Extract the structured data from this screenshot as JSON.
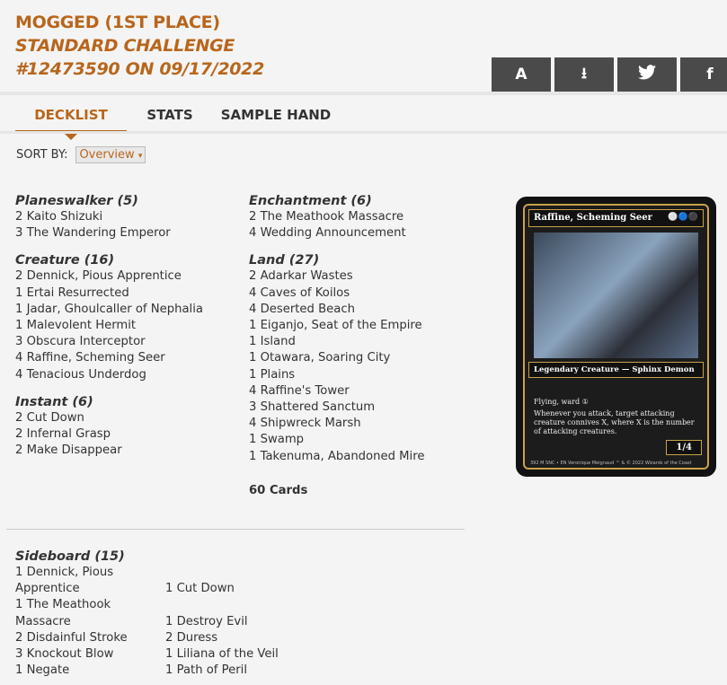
{
  "header": {
    "title": "MOGGED (1ST PLACE)",
    "subtitle1": "STANDARD CHALLENGE",
    "subtitle2": "#12473590 ON 09/17/2022"
  },
  "share": [
    {
      "icon": "arena-icon",
      "label": "A"
    },
    {
      "icon": "download-icon",
      "label": "⭳"
    },
    {
      "icon": "twitter-icon",
      "label": "🐦"
    },
    {
      "icon": "facebook-icon",
      "label": "f"
    }
  ],
  "tabs": [
    "DECKLIST",
    "STATS",
    "SAMPLE HAND"
  ],
  "sort": {
    "label": "SORT BY:",
    "value": "Overview"
  },
  "accent": "#b8661c",
  "left_groups": [
    {
      "title": "Planeswalker (5)",
      "cards": [
        "2 Kaito Shizuki",
        "3 The Wandering Emperor"
      ]
    },
    {
      "title": "Creature (16)",
      "cards": [
        "2 Dennick, Pious Apprentice",
        "1 Ertai Resurrected",
        "1 Jadar, Ghoulcaller of Nephalia",
        "1 Malevolent Hermit",
        "3 Obscura Interceptor",
        "4 Raffine, Scheming Seer",
        "4 Tenacious Underdog"
      ]
    },
    {
      "title": "Instant (6)",
      "cards": [
        "2 Cut Down",
        "2 Infernal Grasp",
        "2 Make Disappear"
      ]
    }
  ],
  "right_groups": [
    {
      "title": "Enchantment (6)",
      "cards": [
        "2 The Meathook Massacre",
        "4 Wedding Announcement"
      ]
    },
    {
      "title": "Land (27)",
      "cards": [
        "2 Adarkar Wastes",
        "4 Caves of Koilos",
        "4 Deserted Beach",
        "1 Eiganjo, Seat of the Empire",
        "1 Island",
        "1 Otawara, Soaring City",
        "1 Plains",
        "4 Raffine's Tower",
        "3 Shattered Sanctum",
        "4 Shipwreck Marsh",
        "1 Swamp",
        "1 Takenuma, Abandoned Mire"
      ]
    }
  ],
  "total": "60 Cards",
  "card": {
    "name": "Raffine, Scheming Seer",
    "mana": "⚪🔵⚫",
    "type": "Legendary Creature — Sphinx Demon",
    "text1": "Flying, ward ①",
    "text2": "Whenever you attack, target attacking creature connives X, where X is the number of attacking creatures.",
    "pt": "1/4",
    "footer": "392 M SNC • EN  Veronique Meignaud   ™ & © 2022 Wizards of the Coast"
  },
  "sideboard": {
    "title": "Sideboard (15)",
    "cards": [
      "1 Dennick, Pious Apprentice",
      "1 Cut Down",
      "1 The Meathook Massacre",
      "1 Destroy Evil",
      "2 Disdainful Stroke",
      "2 Duress",
      "3 Knockout Blow",
      "1 Liliana of the Veil",
      "1 Negate",
      "1 Path of Peril"
    ]
  }
}
